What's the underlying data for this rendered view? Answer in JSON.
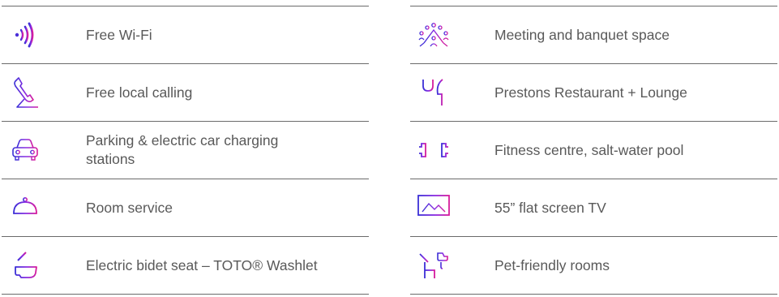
{
  "colors": {
    "icon_gradient_start": "#3a2fd6",
    "icon_gradient_mid": "#8a2be2",
    "icon_gradient_end": "#d81b9a",
    "divider": "#6b6b6b",
    "text": "#595959"
  },
  "amenities": {
    "left": [
      {
        "icon": "wifi-icon",
        "label": "Free Wi-Fi"
      },
      {
        "icon": "phone-icon",
        "label": "Free local calling"
      },
      {
        "icon": "car-icon",
        "label": "Parking & electric car charging stations"
      },
      {
        "icon": "room-service-cloche-icon",
        "label": "Room service"
      },
      {
        "icon": "bidet-toilet-icon",
        "label": "Electric bidet seat – TOTO® Washlet"
      }
    ],
    "right": [
      {
        "icon": "meeting-people-icon",
        "label": "Meeting and banquet space"
      },
      {
        "icon": "fork-knife-icon",
        "label": "Prestons Restaurant + Lounge"
      },
      {
        "icon": "dumbbell-icon",
        "label": "Fitness centre, salt-water pool"
      },
      {
        "icon": "tv-screen-icon",
        "label": "55” flat screen TV"
      },
      {
        "icon": "pet-dog-icon",
        "label": "Pet-friendly rooms"
      }
    ]
  }
}
